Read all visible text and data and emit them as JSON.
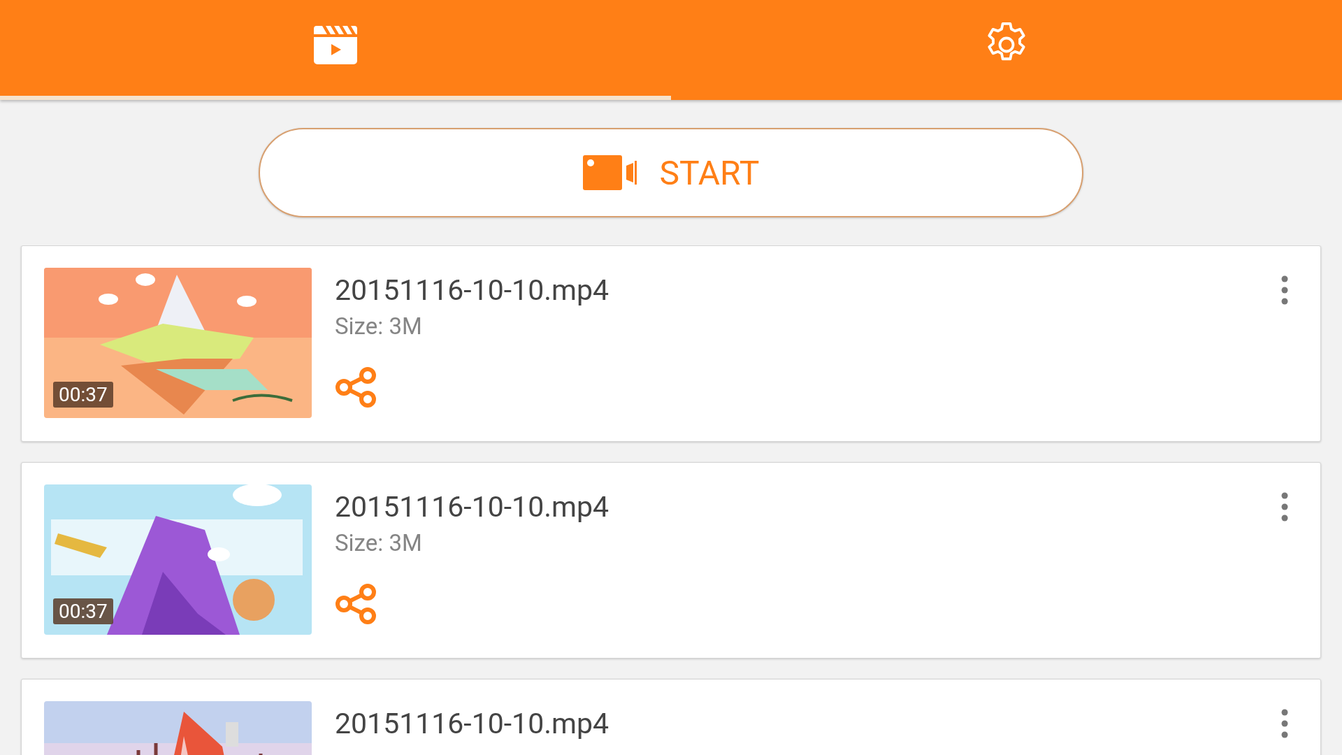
{
  "tabs": [
    {
      "selected": true
    },
    {
      "selected": false
    }
  ],
  "start_button": {
    "label": "START"
  },
  "videos": [
    {
      "name": "20151116-10-10.mp4",
      "size": "Size: 3M",
      "duration": "00:37"
    },
    {
      "name": "20151116-10-10.mp4",
      "size": "Size: 3M",
      "duration": "00:37"
    },
    {
      "name": "20151116-10-10.mp4"
    }
  ]
}
